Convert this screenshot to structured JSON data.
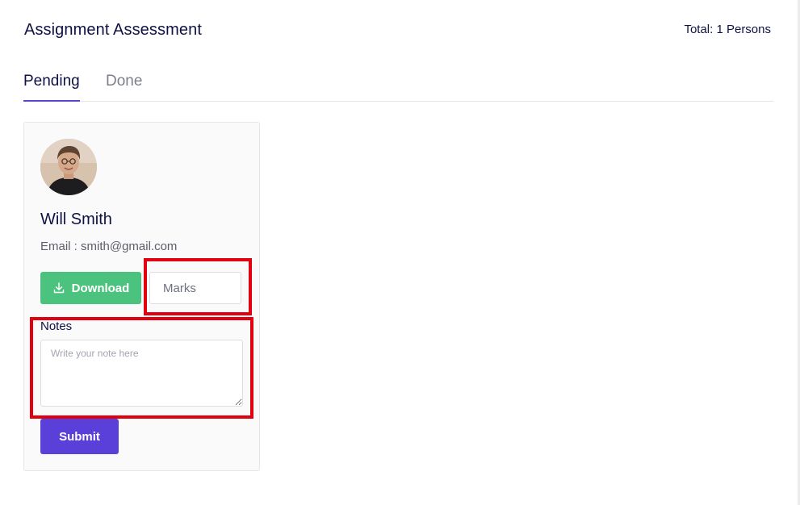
{
  "header": {
    "title": "Assignment Assessment",
    "total": "Total: 1 Persons"
  },
  "tabs": [
    {
      "label": "Pending",
      "active": true
    },
    {
      "label": "Done",
      "active": false
    }
  ],
  "card": {
    "name": "Will Smith",
    "email": "Email : smith@gmail.com",
    "download_label": "Download",
    "marks_placeholder": "Marks",
    "notes_label": "Notes",
    "notes_placeholder": "Write your note here",
    "submit_label": "Submit"
  },
  "colors": {
    "accent": "#5b3fd9",
    "download": "#4cc27f",
    "highlight": "#e0000f",
    "text_dark": "#0f1146"
  }
}
